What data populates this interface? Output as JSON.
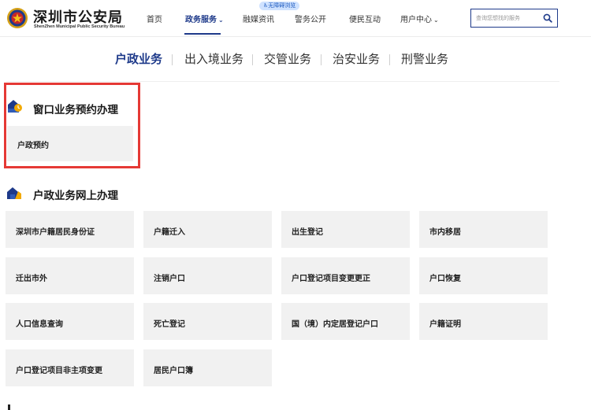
{
  "header": {
    "title": "深圳市公安局",
    "subtitle": "ShenZhen Municipal Public Security Bureau",
    "accessibility_badge": "无障碍浏览",
    "search_placeholder": "查询您想找的服务"
  },
  "nav": {
    "items": [
      {
        "label": "首页",
        "active": false
      },
      {
        "label": "政务服务",
        "active": true
      },
      {
        "label": "融媒资讯",
        "active": false
      },
      {
        "label": "警务公开",
        "active": false
      },
      {
        "label": "便民互动",
        "active": false
      },
      {
        "label": "用户中心",
        "active": false
      }
    ]
  },
  "category_tabs": [
    {
      "label": "户政业务",
      "active": true
    },
    {
      "label": "出入境业务",
      "active": false
    },
    {
      "label": "交管业务",
      "active": false
    },
    {
      "label": "治安业务",
      "active": false
    },
    {
      "label": "刑警业务",
      "active": false
    }
  ],
  "sections": [
    {
      "title": "窗口业务预约办理",
      "items": [
        "户政预约"
      ]
    },
    {
      "title": "户政业务网上办理",
      "items": [
        "深圳市户籍居民身份证",
        "户籍迁入",
        "出生登记",
        "市内移居",
        "迁出市外",
        "注销户口",
        "户口登记项目变更更正",
        "户口恢复",
        "人口信息查询",
        "死亡登记",
        "国（境）内定居登记户口",
        "户籍证明",
        "户口登记项目非主项变更",
        "居民户口簿"
      ]
    }
  ],
  "colors": {
    "brand": "#1e3a8a",
    "highlight": "#e53935",
    "card_bg": "#f1f1f1"
  }
}
